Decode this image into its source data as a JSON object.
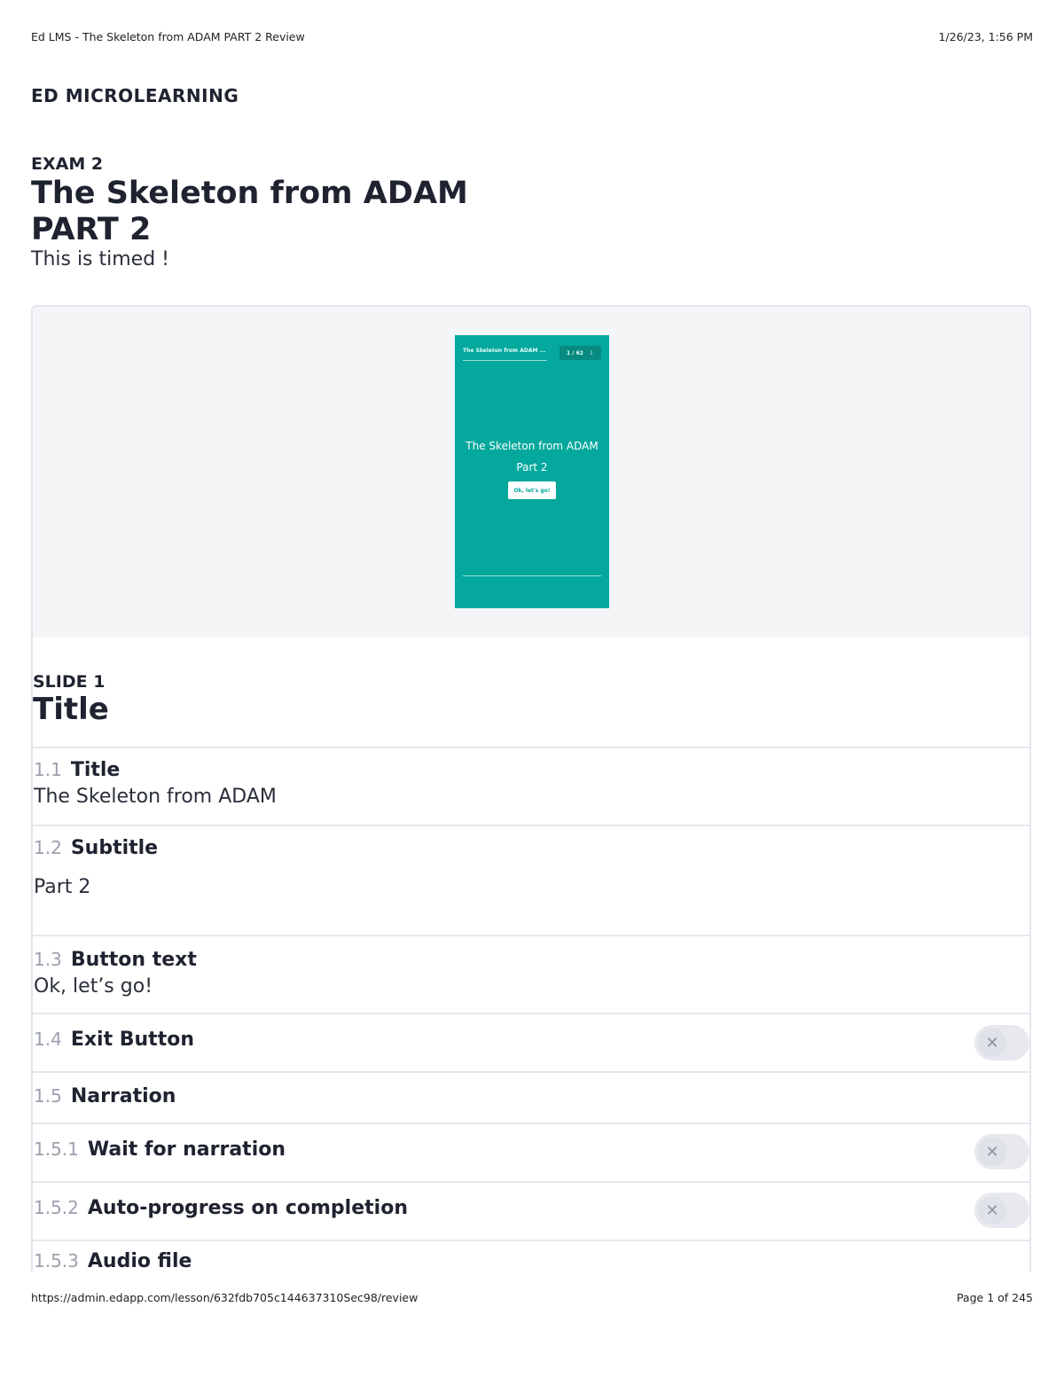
{
  "print_header": {
    "left": "Ed LMS - The Skeleton from ADAM PART 2 Review",
    "right": "1/26/23, 1:56 PM"
  },
  "brand": "ED MICROLEARNING",
  "lesson": {
    "label": "EXAM 2",
    "title_line1": "The Skeleton from ADAM",
    "title_line2": "PART 2",
    "description": "This is timed !"
  },
  "preview": {
    "header_title": "The Skeleton from ADAM ...",
    "counter": "1 / 62",
    "menu_icon": "more-vertical-icon",
    "main_line1": "The Skeleton from ADAM",
    "main_line2": "Part 2",
    "button": "Ok, let's go!",
    "background_color": "#04a89d"
  },
  "slide": {
    "label": "SLIDE 1",
    "title": "Title",
    "fields": [
      {
        "num": "1.1",
        "title": "Title",
        "value": "The Skeleton from ADAM"
      },
      {
        "num": "1.2",
        "title": "Subtitle",
        "value": "Part 2"
      },
      {
        "num": "1.3",
        "title": "Button text",
        "value": "Ok, let’s go!"
      },
      {
        "num": "1.4",
        "title": "Exit Button",
        "toggle": false
      },
      {
        "num": "1.5",
        "title": "Narration"
      },
      {
        "num": "1.5.1",
        "title": "Wait for narration",
        "toggle": false
      },
      {
        "num": "1.5.2",
        "title": "Auto-progress on completion",
        "toggle": false
      },
      {
        "num": "1.5.3",
        "title": "Audio file"
      }
    ]
  },
  "toggle_off_glyph": "✕",
  "print_footer": {
    "left": "https://admin.edapp.com/lesson/632fdb705c144637310Sec98/review",
    "right": "Page 1 of 245"
  }
}
